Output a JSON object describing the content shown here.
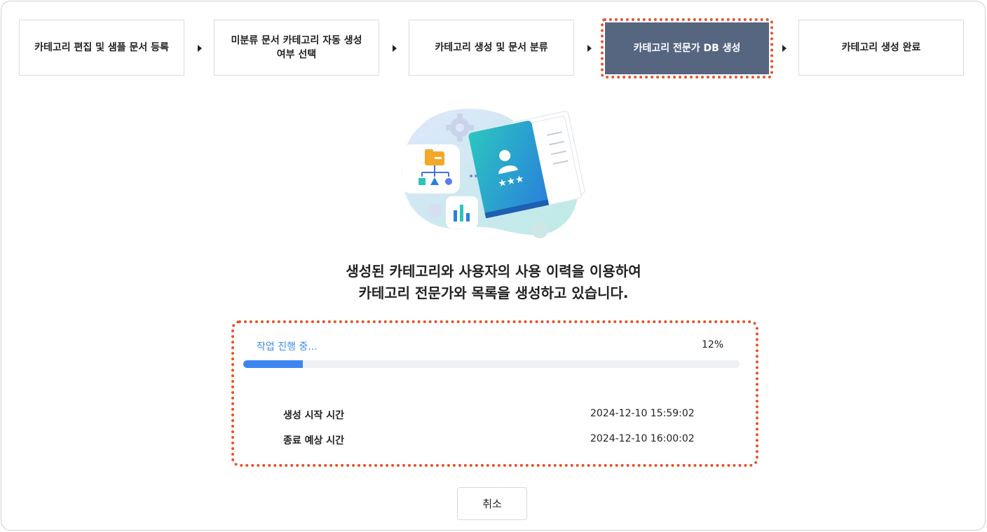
{
  "steps": [
    {
      "label": "카테고리 편집 및 샘플 문서 등록",
      "active": false
    },
    {
      "label": "미분류 문서 카테고리 자동 생성 여부 선택",
      "active": false
    },
    {
      "label": "카테고리 생성 및 문서 분류",
      "active": false
    },
    {
      "label": "카테고리 전문가 DB 생성",
      "active": true
    },
    {
      "label": "카테고리 생성 완료",
      "active": false
    }
  ],
  "message": {
    "line1": "생성된 카테고리와 사용자의 사용 이력을 이용하여",
    "line2": "카테고리 전문가와 목록을 생성하고 있습니다."
  },
  "progress": {
    "status": "작업 진행 중...",
    "percent_label": "12%",
    "value": 0.12
  },
  "times": {
    "start_label": "생성 시작 시간",
    "start_value": "2024-12-10 15:59:02",
    "end_label": "종료 예상 시간",
    "end_value": "2024-12-10 16:00:02"
  },
  "cancel_label": "취소",
  "colors": {
    "active_step": "#566580",
    "highlight": "#e8512a",
    "progress": "#3d86ef",
    "status_text": "#3d8ce8"
  },
  "icons": [
    "folder-hierarchy-icon",
    "bar-chart-icon",
    "expert-book-icon",
    "gear-icon"
  ]
}
